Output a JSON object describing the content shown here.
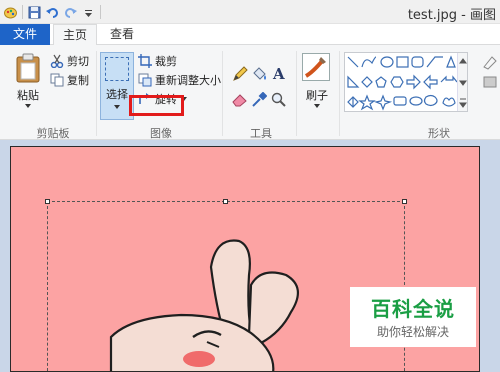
{
  "window": {
    "title": "test.jpg - 画图"
  },
  "tabs": {
    "file": "文件",
    "home": "主页",
    "view": "查看"
  },
  "clipboard": {
    "paste": "粘贴",
    "cut": "剪切",
    "copy": "复制",
    "label": "剪贴板"
  },
  "image": {
    "select": "选择",
    "crop": "裁剪",
    "resize": "重新调整大小",
    "rotate": "旋转",
    "label": "图像"
  },
  "tools": {
    "label": "工具"
  },
  "brushes": {
    "label": "刷子"
  },
  "shapes": {
    "label": "形状"
  },
  "watermark": {
    "title": "百科全说",
    "subtitle": "助你轻松解决"
  },
  "colors": {
    "accent": "#1e64c8",
    "highlight": "#e21b1b",
    "canvas_bg": "#fca3a3",
    "watermark_green": "#1a9e44"
  }
}
